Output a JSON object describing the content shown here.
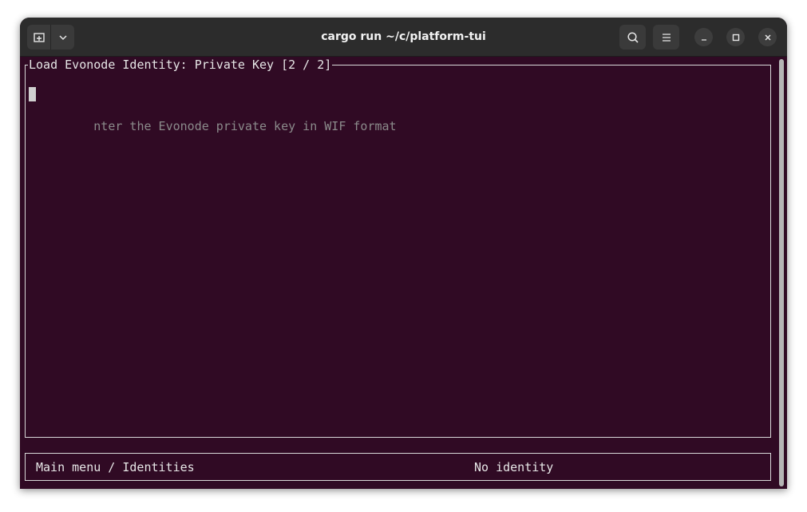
{
  "window": {
    "title": "cargo run ~/c/platform-tui"
  },
  "titlebar": {
    "new_tab_icon": "new-tab-icon",
    "dropdown_icon": "chevron-down-icon",
    "search_icon": "search-icon",
    "menu_icon": "hamburger-menu-icon",
    "minimize_icon": "minimize-icon",
    "maximize_icon": "maximize-icon",
    "close_icon": "close-icon"
  },
  "terminal": {
    "panel_title": "Load Evonode Identity: Private Key [2 / 2]",
    "input_placeholder_first": "E",
    "input_placeholder_rest": "nter the Evonode private key in WIF format",
    "status_left": "Main menu / Identities",
    "status_right": "No identity"
  },
  "colors": {
    "terminal_bg": "#300a24",
    "titlebar_bg": "#2c2c2c",
    "text": "#e6e6e6",
    "placeholder": "#8b8b8b"
  }
}
